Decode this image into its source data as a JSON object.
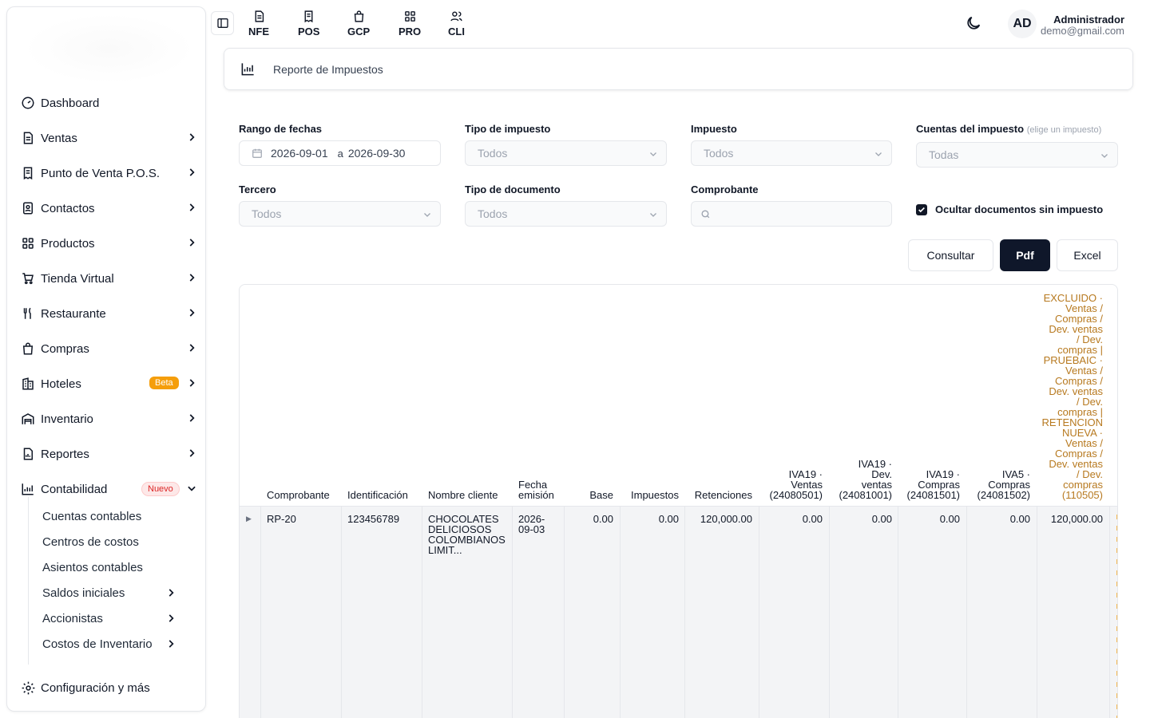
{
  "topbar": {
    "apps": [
      {
        "label": "NFE",
        "icon": "document-icon"
      },
      {
        "label": "POS",
        "icon": "pos-receipt-icon"
      },
      {
        "label": "GCP",
        "icon": "shopping-bag-icon"
      },
      {
        "label": "PRO",
        "icon": "grid-icon"
      },
      {
        "label": "CLI",
        "icon": "users-icon"
      }
    ],
    "avatar_initials": "AD",
    "user_name": "Administrador",
    "user_email": "demo@gmail.com"
  },
  "sidebar": {
    "items": [
      {
        "label": "Dashboard",
        "icon": "dashboard-gauge-icon"
      },
      {
        "label": "Ventas",
        "icon": "document-icon"
      },
      {
        "label": "Punto de Venta P.O.S.",
        "icon": "pos-receipt-icon"
      },
      {
        "label": "Contactos",
        "icon": "contacts-book-icon"
      },
      {
        "label": "Productos",
        "icon": "grid-icon"
      },
      {
        "label": "Tienda Virtual",
        "icon": "cart-icon"
      },
      {
        "label": "Restaurante",
        "icon": "utensils-icon"
      },
      {
        "label": "Compras",
        "icon": "shopping-bag-icon"
      },
      {
        "label": "Hoteles",
        "icon": "building-icon",
        "badge": "Beta"
      },
      {
        "label": "Inventario",
        "icon": "warehouse-icon"
      },
      {
        "label": "Reportes",
        "icon": "report-icon"
      },
      {
        "label": "Contabilidad",
        "icon": "chart-icon",
        "badge": "Nuevo"
      }
    ],
    "sub_items": [
      {
        "label": "Cuentas contables"
      },
      {
        "label": "Centros de costos"
      },
      {
        "label": "Asientos contables"
      },
      {
        "label": "Saldos iniciales"
      },
      {
        "label": "Accionistas"
      },
      {
        "label": "Costos de Inventario"
      }
    ],
    "config_label": "Configuración y más"
  },
  "page": {
    "title": "Reporte de Impuestos"
  },
  "filters": {
    "date_range_label": "Rango de fechas",
    "date_from": "2026-09-01",
    "date_sep": "a",
    "date_to": "2026-09-30",
    "tax_type_label": "Tipo de impuesto",
    "tax_type_value": "Todos",
    "tax_label": "Impuesto",
    "tax_value": "Todos",
    "accounts_label": "Cuentas del impuesto",
    "accounts_hint": "(elige un impuesto)",
    "accounts_value": "Todas",
    "third_label": "Tercero",
    "third_value": "Todos",
    "doc_type_label": "Tipo de documento",
    "doc_type_value": "Todos",
    "voucher_label": "Comprobante",
    "voucher_value": "",
    "hide_label": "Ocultar documentos sin impuesto",
    "hide_checked": true
  },
  "actions": {
    "consult": "Consultar",
    "pdf": "Pdf",
    "excel": "Excel"
  },
  "table": {
    "headers": {
      "comprobante": "Comprobante",
      "identificacion": "Identificación",
      "nombre": "Nombre cliente",
      "fecha_1": "Fecha",
      "fecha_2": "emisión",
      "base": "Base",
      "impuestos": "Impuestos",
      "retenciones": "Retenciones",
      "iva19v_1": "IVA19 ·",
      "iva19v_2": "Ventas",
      "iva19v_3": "(24080501)",
      "iva19dv_1": "IVA19 ·",
      "iva19dv_2": "Dev.",
      "iva19dv_3": "ventas",
      "iva19dv_4": "(24081001)",
      "iva19c_1": "IVA19 ·",
      "iva19c_2": "Compras",
      "iva19c_3": "(24081501)",
      "iva5c_1": "IVA5 ·",
      "iva5c_2": "Compras",
      "iva5c_3": "(24081502)",
      "long_lines": [
        "EXCLUIDO ·",
        "Ventas /",
        "Compras /",
        "Dev. ventas",
        "/ Dev.",
        "compras |",
        "PRUEBAIC ·",
        "Ventas /",
        "Compras /",
        "Dev. ventas",
        "/ Dev.",
        "compras |",
        "RETENCION",
        "NUEVA ·",
        "Ventas /",
        "Compras /",
        "Dev. ventas",
        "/ Dev.",
        "compras",
        "(110505)"
      ]
    },
    "rows": [
      {
        "comprobante": "RP-20",
        "identificacion": "123456789",
        "nombre_1": "CHOCOLATES",
        "nombre_2": "DELICIOSOS",
        "nombre_3": "COLOMBIANOS",
        "nombre_4": "LIMIT...",
        "fecha_1": "2026-",
        "fecha_2": "09-03",
        "base": "0.00",
        "impuestos": "0.00",
        "retenciones": "120,000.00",
        "iva19v": "0.00",
        "iva19dv": "0.00",
        "iva19c": "0.00",
        "iva5c": "0.00",
        "long": "120,000.00"
      }
    ]
  },
  "colors": {
    "accent_dark": "#0f172a",
    "header_gold": "#b7791f",
    "beta_badge": "#f59e0b",
    "nuevo_badge": "#dc2626"
  }
}
